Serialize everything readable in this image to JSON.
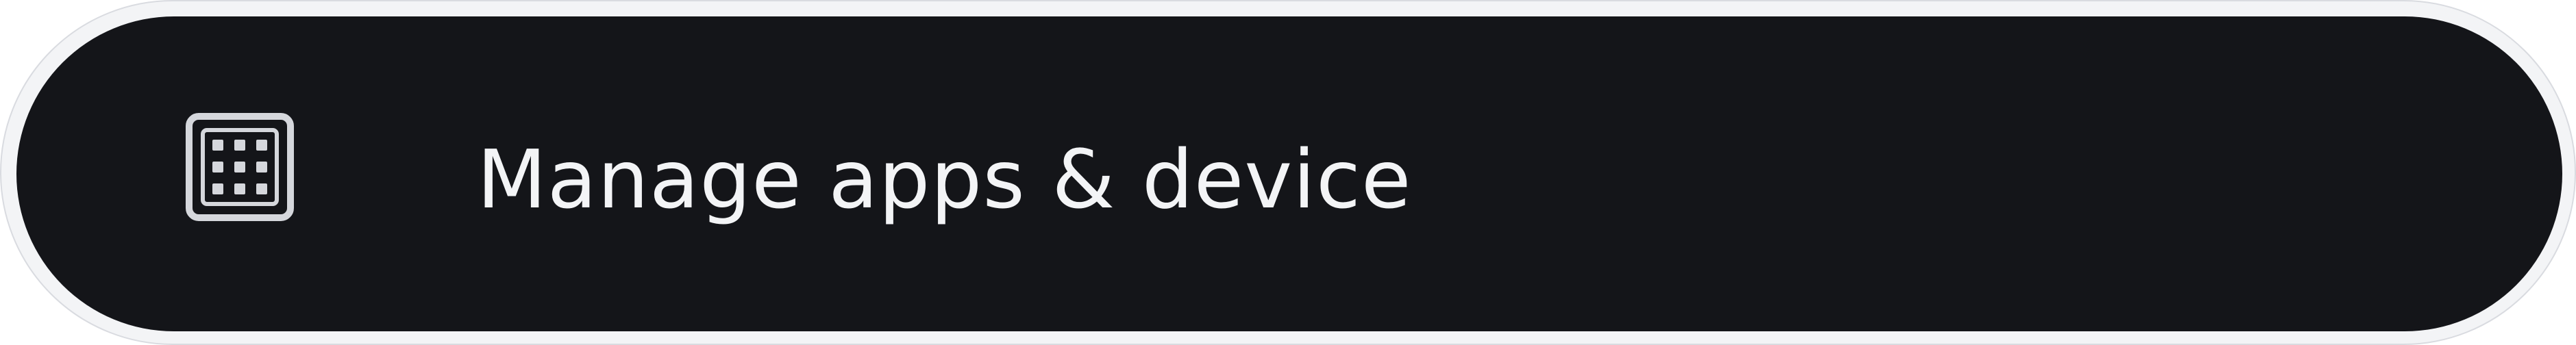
{
  "menu_item": {
    "icon": "apps-grid-icon",
    "label": "Manage apps & device"
  },
  "colors": {
    "item_background": "#141519",
    "text": "#f3f4f6",
    "icon": "#d5d7dc"
  }
}
